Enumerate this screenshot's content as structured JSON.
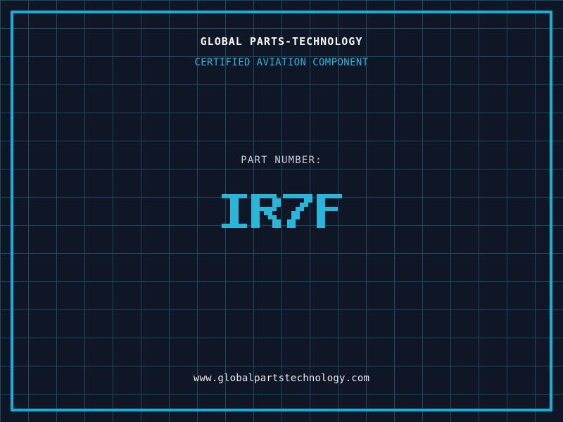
{
  "colors": {
    "background": "#0f1726",
    "grid_line": "#1c4a5f",
    "frame": "#12b1d9",
    "accent": "#29b6db",
    "title_text": "#f5f7fa",
    "muted_text": "#c9ced8",
    "url_text": "#e8ebf0"
  },
  "header": {
    "company_name": "GLOBAL PARTS-TECHNOLOGY",
    "tagline": "CERTIFIED AVIATION COMPONENT"
  },
  "part": {
    "label": "PART NUMBER:",
    "number": "IR7F"
  },
  "footer": {
    "website": "www.globalpartstechnology.com"
  }
}
